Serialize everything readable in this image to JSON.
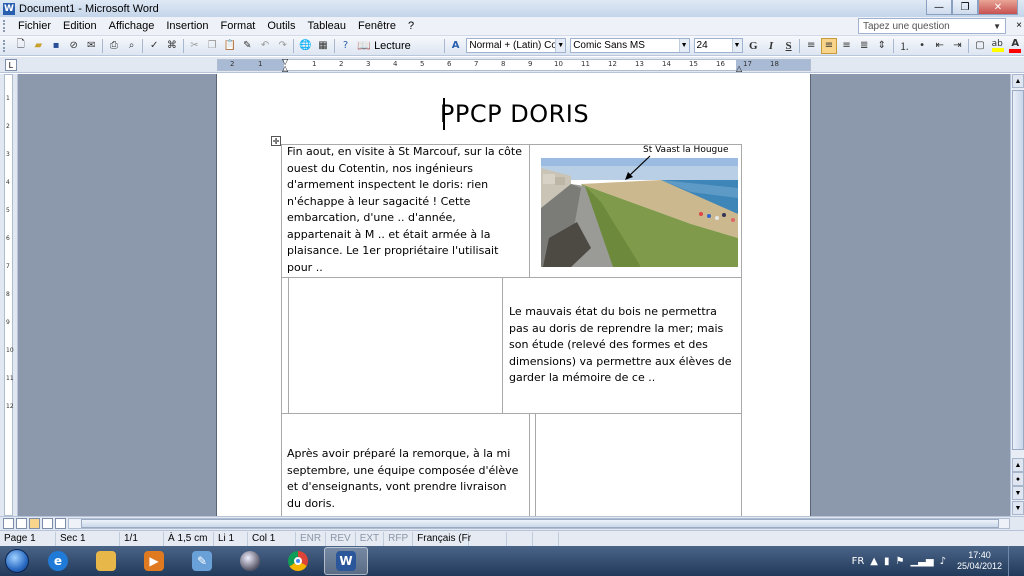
{
  "window": {
    "title": "Document1 - Microsoft Word",
    "app_icon": "W",
    "controls": {
      "minimize": "—",
      "maximize": "❐",
      "close": "✕"
    }
  },
  "menubar": {
    "items": [
      "Fichier",
      "Edition",
      "Affichage",
      "Insertion",
      "Format",
      "Outils",
      "Tableau",
      "Fenêtre",
      "?"
    ],
    "help_placeholder": "Tapez une question",
    "close_doc": "×"
  },
  "toolbar": {
    "reading_label": "Lecture",
    "style_value": "Normal + (Latin) Comi",
    "font_value": "Comic Sans MS",
    "size_value": "24",
    "bold": "G",
    "italic": "I",
    "underline": "S",
    "highlight_color": "#ffff00",
    "font_color": "#ff0000"
  },
  "ruler": {
    "ticks": [
      "2",
      "1",
      "1",
      "2",
      "3",
      "4",
      "5",
      "6",
      "7",
      "8",
      "9",
      "10",
      "11",
      "12",
      "13",
      "14",
      "15",
      "16",
      "17",
      "18"
    ],
    "vticks": [
      "1",
      "2",
      "3",
      "4",
      "5",
      "6",
      "7",
      "8",
      "9",
      "10",
      "11",
      "12"
    ],
    "tab_selector": "L"
  },
  "document": {
    "title": "PPCP DORIS",
    "cell1": "Fin aout, en visite à St Marcouf, sur la côte ouest du Cotentin, nos ingénieurs d'armement inspectent le doris: rien n'échappe à leur sagacité ! Cette embarcation, d'une .. d'année, appartenait à M .. et était armée à la plaisance. Le 1er propriétaire l'utilisait pour ..",
    "photo_caption": "St Vaast la Hougue",
    "cell4": "Le mauvais état du bois ne permettra pas au doris de reprendre la mer; mais son étude (relevé des formes et des dimensions) va permettre aux élèves de garder la mémoire de ce ..",
    "cell5": "Après avoir préparé la remorque, à la mi septembre, une équipe composée d'élève et d'enseignants, vont prendre livraison du doris.",
    "table_handle": "✛"
  },
  "statusbar": {
    "page": "Page 1",
    "section": "Sec 1",
    "pages": "1/1",
    "position": "À 1,5 cm",
    "line": "Li 1",
    "column": "Col 1",
    "enr": "ENR",
    "rev": "REV",
    "ext": "EXT",
    "rfp": "RFP",
    "language": "Français (Fr"
  },
  "taskbar": {
    "language": "FR",
    "time": "17:40",
    "date": "25/04/2012",
    "apps": [
      "internet-explorer",
      "file-explorer",
      "media-player",
      "paint",
      "globe",
      "chrome",
      "word"
    ]
  }
}
